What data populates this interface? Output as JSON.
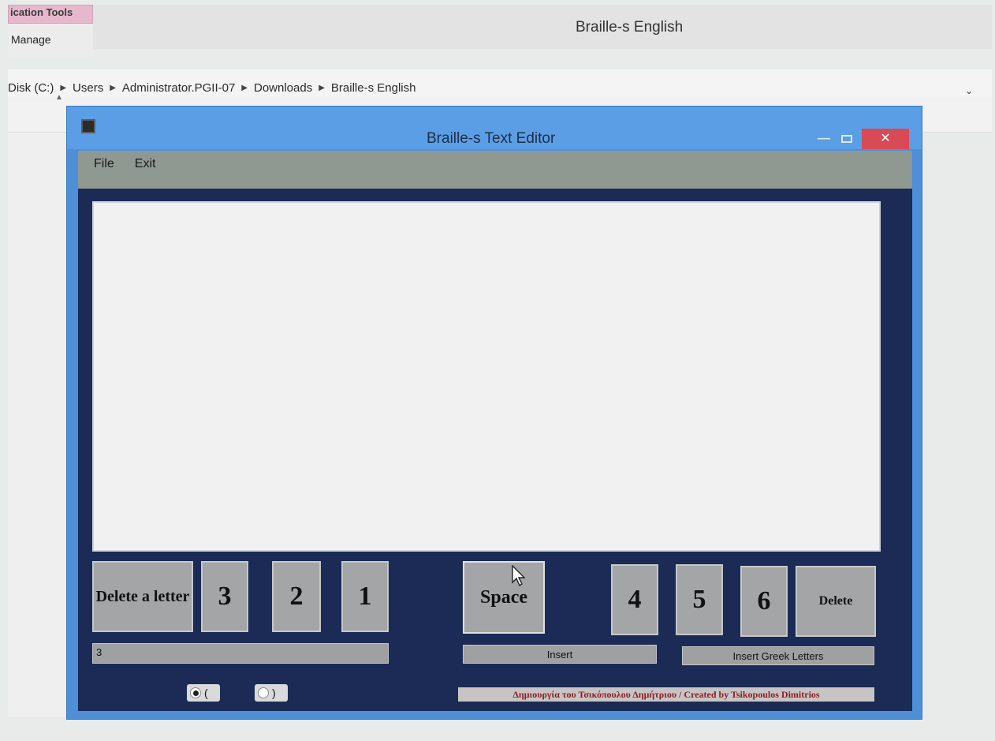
{
  "explorer": {
    "ribbon_context_tab": "ication Tools",
    "ribbon_manage": "Manage",
    "window_title": "Braille-s English",
    "breadcrumb": [
      "Disk (C:)",
      "Users",
      "Administrator.PGII-07",
      "Downloads",
      "Braille-s English"
    ]
  },
  "app": {
    "title": "Braille-s Text Editor",
    "menu": [
      "File",
      "Exit"
    ],
    "text_content": "",
    "keys": {
      "delete_letter": "Delete a letter",
      "dot3": "3",
      "dot2": "2",
      "dot1": "1",
      "space": "Space",
      "dot4": "4",
      "dot5": "5",
      "dot6": "6",
      "delete": "Delete"
    },
    "status_value": "3",
    "insert_label": "Insert",
    "insert_greek_label": "Insert Greek Letters",
    "radio_open": "(",
    "radio_close": ")",
    "radio_selected": "(",
    "credit": "Δημιουργία του Τσικόπουλου Δημήτριου / Created by Tsikopoulos Dimitrios"
  },
  "icons": {
    "app_icon": "app-icon",
    "minimize": "minimize-icon",
    "maximize": "maximize-icon",
    "close": "close-icon",
    "cursor": "mouse-pointer-icon"
  },
  "colors": {
    "window_frame": "#4e8fd8",
    "client_background": "#1b2b55",
    "menubar": "#8f9891",
    "key": "#a3a5a7",
    "close_button": "#d84a55",
    "credit_text": "#8b1e22"
  }
}
